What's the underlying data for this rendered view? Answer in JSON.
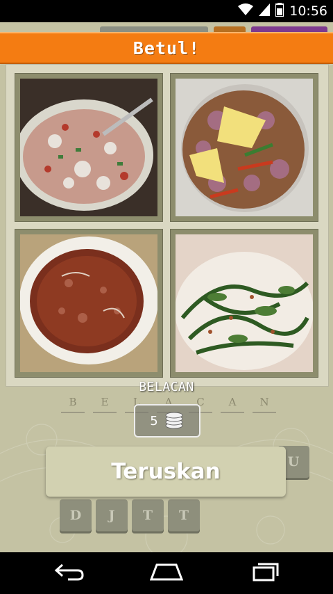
{
  "status": {
    "time": "10:56"
  },
  "banner": {
    "text": "Betul!"
  },
  "answer": {
    "word": "BELACAN",
    "slots": [
      "B",
      "E",
      "L",
      "A",
      "C",
      "A",
      "N"
    ]
  },
  "coins": {
    "count": "5"
  },
  "continue_button": {
    "label": "Teruskan"
  },
  "keys": {
    "row_top_right": "U",
    "row_bottom": [
      "D",
      "J",
      "T",
      "T"
    ]
  },
  "images": [
    {
      "name": "rice-salad-photo"
    },
    {
      "name": "shallot-lime-sambal-photo"
    },
    {
      "name": "chili-paste-photo"
    },
    {
      "name": "stir-fried-greens-photo"
    }
  ],
  "colors": {
    "banner": "#f47c12",
    "background": "#c4c2a3",
    "button": "#d2d1b1",
    "key": "#8e8f7c"
  }
}
